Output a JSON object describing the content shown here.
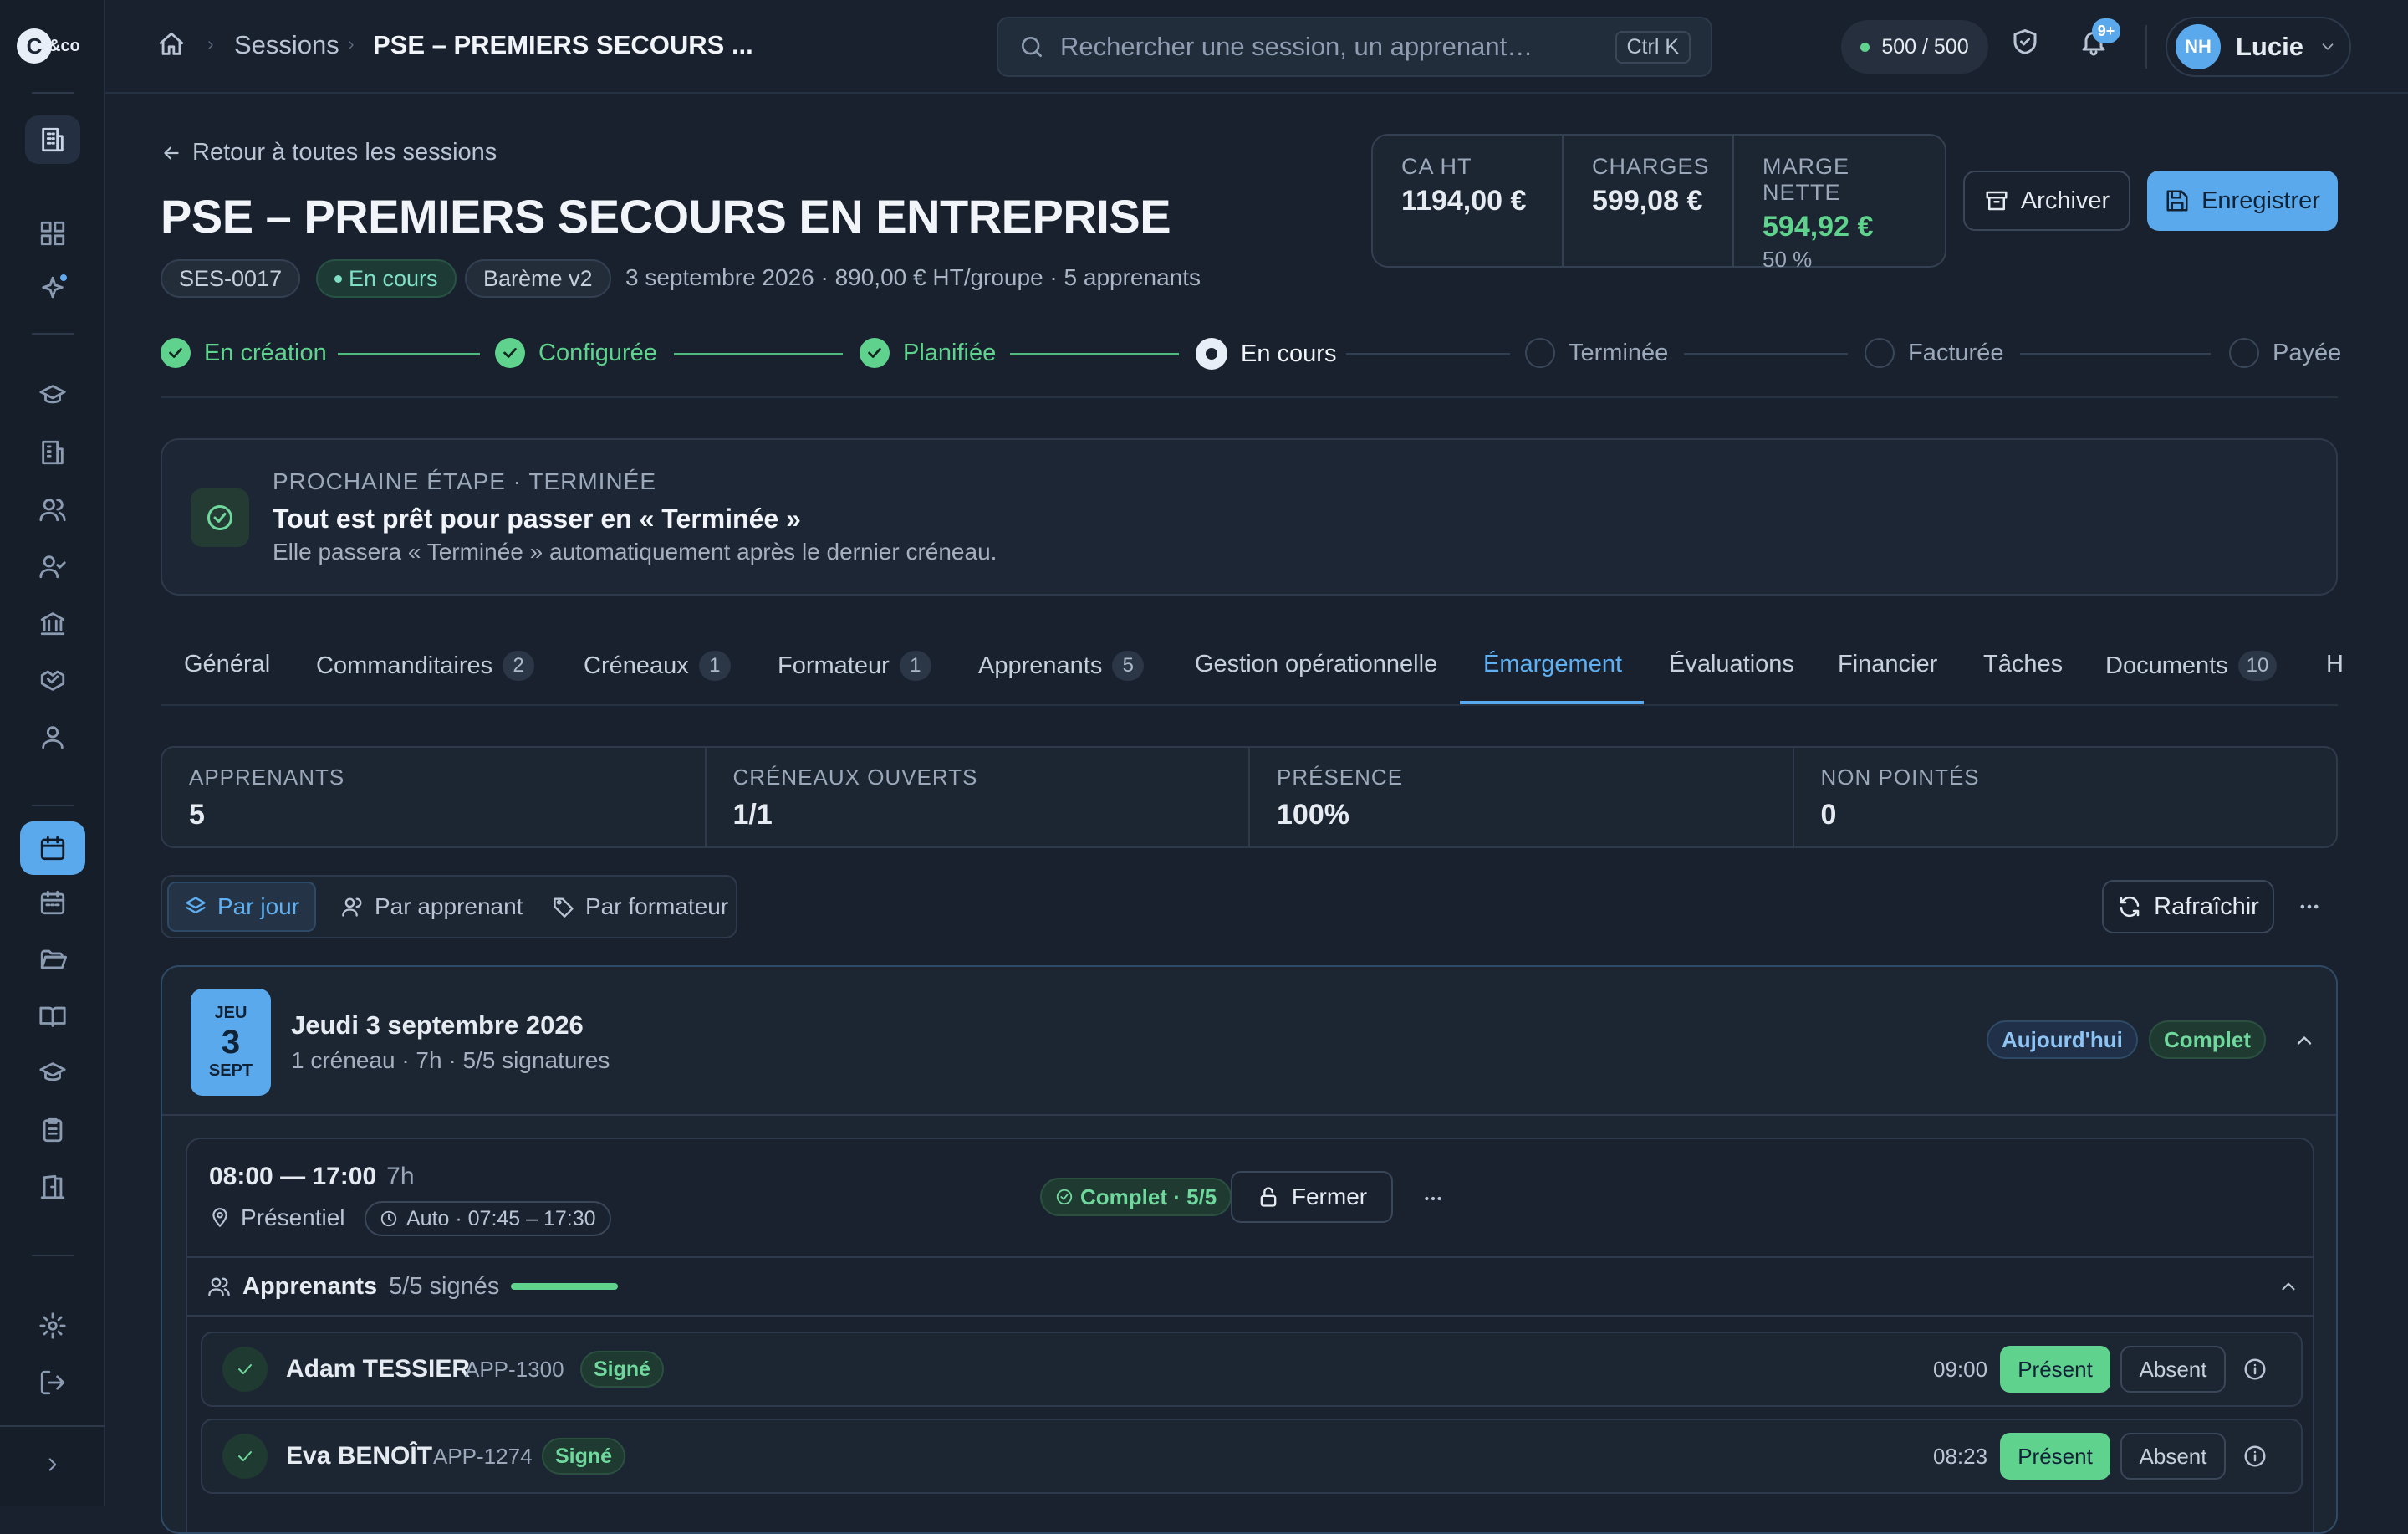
{
  "brand": {
    "logo_letter": "C",
    "logo_suffix": "&co"
  },
  "topbar": {
    "breadcrumb": [
      "Sessions",
      "PSE – PREMIERS SECOURS ..."
    ],
    "search_placeholder": "Rechercher une session, un apprenant…",
    "search_shortcut": "Ctrl K",
    "credits": "500 / 500",
    "notif_badge": "9+",
    "user_initials": "NH",
    "user_name": "Lucie"
  },
  "header": {
    "back_label": "Retour à toutes les sessions",
    "title": "PSE – PREMIERS SECOURS EN ENTREPRISE",
    "chips": {
      "id": "SES-0017",
      "status": "En cours",
      "bareme": "Barème v2"
    },
    "meta": "3 septembre 2026 · 890,00 € HT/groupe · 5 apprenants"
  },
  "finance": {
    "ca_label": "CA HT",
    "ca_value": "1194,00 €",
    "charges_label": "CHARGES",
    "charges_value": "599,08 €",
    "marge_label": "MARGE NETTE",
    "marge_value": "594,92 €",
    "marge_pct": "50 %"
  },
  "actions": {
    "archive": "Archiver",
    "save": "Enregistrer"
  },
  "steps": [
    {
      "label": "En création",
      "state": "done"
    },
    {
      "label": "Configurée",
      "state": "done"
    },
    {
      "label": "Planifiée",
      "state": "done"
    },
    {
      "label": "En cours",
      "state": "current"
    },
    {
      "label": "Terminée",
      "state": "todo"
    },
    {
      "label": "Facturée",
      "state": "todo"
    },
    {
      "label": "Payée",
      "state": "todo"
    }
  ],
  "next_step": {
    "label": "PROCHAINE ÉTAPE · TERMINÉE",
    "title": "Tout est prêt pour passer en « Terminée »",
    "desc": "Elle passera « Terminée » automatiquement après le dernier créneau."
  },
  "tabs": [
    {
      "label": "Général",
      "count": ""
    },
    {
      "label": "Commanditaires",
      "count": "2"
    },
    {
      "label": "Créneaux",
      "count": "1"
    },
    {
      "label": "Formateur",
      "count": "1"
    },
    {
      "label": "Apprenants",
      "count": "5"
    },
    {
      "label": "Gestion opérationnelle",
      "count": ""
    },
    {
      "label": "Émargement",
      "count": ""
    },
    {
      "label": "Évaluations",
      "count": ""
    },
    {
      "label": "Financier",
      "count": ""
    },
    {
      "label": "Tâches",
      "count": ""
    },
    {
      "label": "Documents",
      "count": "10"
    },
    {
      "label": "H",
      "count": ""
    }
  ],
  "stats": [
    {
      "label": "APPRENANTS",
      "value": "5"
    },
    {
      "label": "CRÉNEAUX OUVERTS",
      "value": "1/1"
    },
    {
      "label": "PRÉSENCE",
      "value": "100%"
    },
    {
      "label": "NON POINTÉS",
      "value": "0"
    }
  ],
  "views": {
    "by_day": "Par jour",
    "by_learner": "Par apprenant",
    "by_trainer": "Par formateur",
    "refresh": "Rafraîchir"
  },
  "day": {
    "dow": "JEU",
    "num": "3",
    "month": "SEPT",
    "title": "Jeudi 3 septembre 2026",
    "subtitle": "1 créneau · 7h · 5/5 signatures",
    "today": "Aujourd'hui",
    "complete": "Complet"
  },
  "slot": {
    "time": "08:00 — 17:00",
    "duration": "7h",
    "mode": "Présentiel",
    "auto": "Auto · 07:45 – 17:30",
    "status": "Complet · 5/5",
    "close": "Fermer",
    "learners_label": "Apprenants",
    "learners_signed": "5/5 signés",
    "signed_fraction": 1.0
  },
  "learners": [
    {
      "name": "Adam TESSIER",
      "code": "APP-1300",
      "status": "Signé",
      "time": "09:00",
      "present": "Présent",
      "absent": "Absent"
    },
    {
      "name": "Eva BENOÎT",
      "code": "APP-1274",
      "status": "Signé",
      "time": "08:23",
      "present": "Présent",
      "absent": "Absent"
    }
  ]
}
